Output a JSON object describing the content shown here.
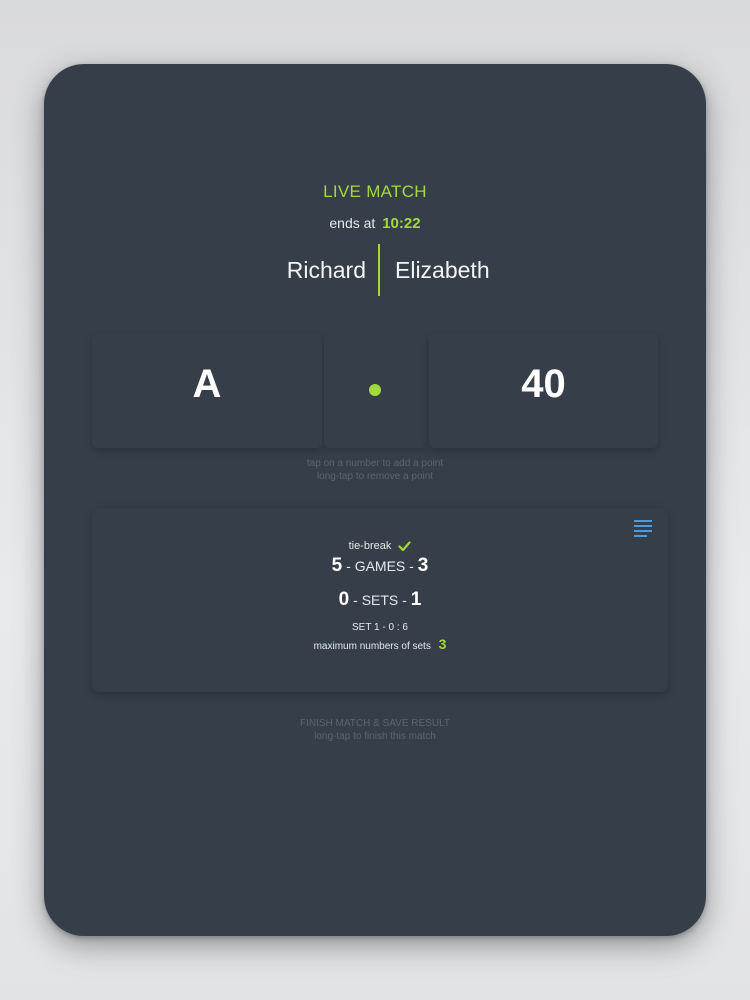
{
  "header": {
    "title": "LIVE MATCH",
    "ends_label": "ends at",
    "ends_time": "10:22"
  },
  "players": {
    "left": "Richard",
    "right": "Elizabeth"
  },
  "score": {
    "left": "A",
    "right": "40",
    "serving": "left",
    "hint_line1": "tap on a number to add a point",
    "hint_line2": "long-tap to remove a point"
  },
  "match_info": {
    "tiebreak_label": "tie-break",
    "tiebreak_enabled": true,
    "games": {
      "left": "5",
      "label": "GAMES",
      "right": "3"
    },
    "sets": {
      "left": "0",
      "label": "SETS",
      "right": "1"
    },
    "set_detail": "SET 1  -  0 : 6",
    "max_sets_label": "maximum numbers of sets",
    "max_sets_value": "3"
  },
  "finish": {
    "label": "FINISH MATCH & SAVE RESULT",
    "hint": "long-tap to finish this match"
  },
  "colors": {
    "accent": "#a4d93b",
    "background": "#363f49",
    "menu_icon": "#4a9be0"
  },
  "icons": {
    "menu": "menu-icon",
    "check": "check-icon",
    "serve": "serve-indicator-icon"
  }
}
